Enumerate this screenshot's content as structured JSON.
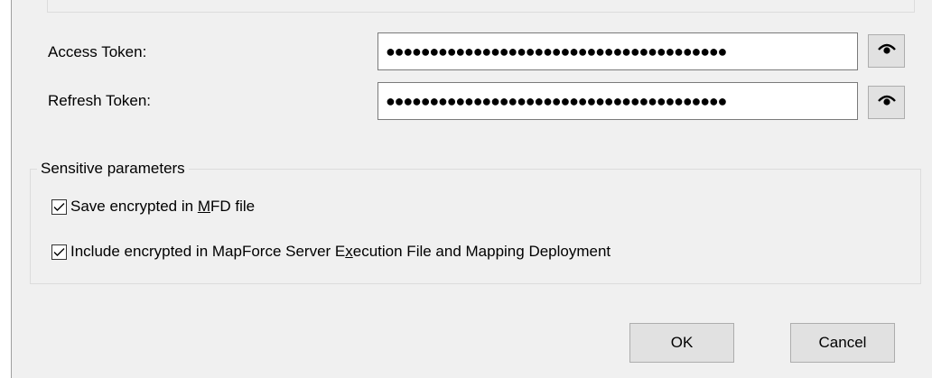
{
  "oauth": {
    "access_token_label": "Access Token:",
    "access_token_value": "●●●●●●●●●●●●●●●●●●●●●●●●●●●●●●●●●●●●●●●",
    "refresh_token_label": "Refresh Token:",
    "refresh_token_value": "●●●●●●●●●●●●●●●●●●●●●●●●●●●●●●●●●●●●●●●",
    "reveal_icon": "eye-icon"
  },
  "sensitive": {
    "title": "Sensitive parameters",
    "options": [
      {
        "pre": "Save encrypted in ",
        "mnemonic": "M",
        "post": "FD file",
        "checked": true
      },
      {
        "pre": "Include encrypted in MapForce Server E",
        "mnemonic": "x",
        "post": "ecution File and Mapping Deployment",
        "checked": true
      }
    ]
  },
  "buttons": {
    "ok": "OK",
    "cancel": "Cancel"
  }
}
